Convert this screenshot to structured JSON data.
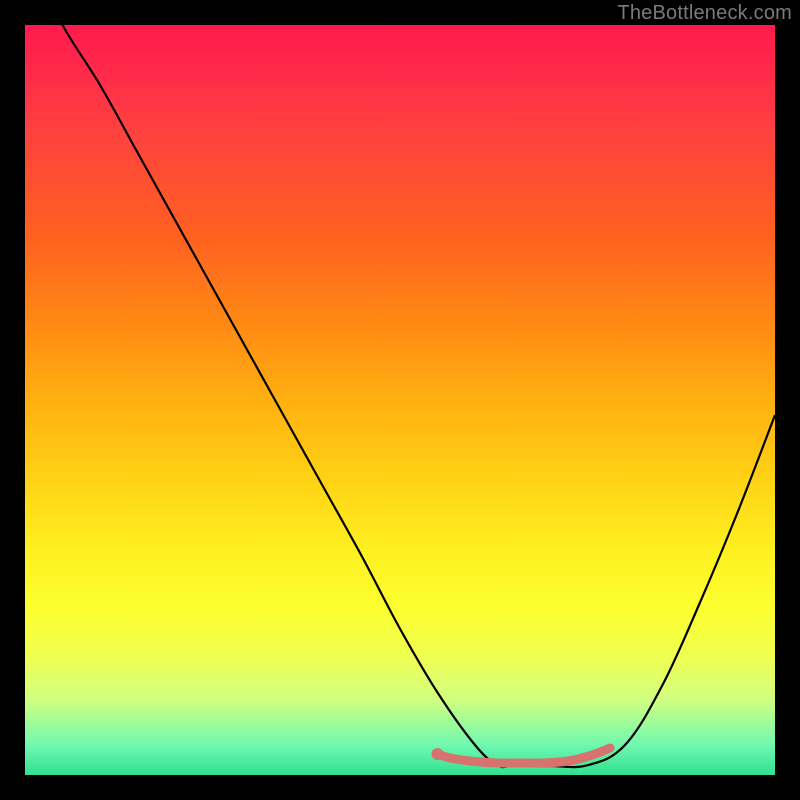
{
  "watermark": "TheBottleneck.com",
  "chart_data": {
    "type": "line",
    "title": "",
    "xlabel": "",
    "ylabel": "",
    "xlim": [
      0,
      100
    ],
    "ylim": [
      0,
      100
    ],
    "series": [
      {
        "name": "bottleneck-curve",
        "x": [
          0,
          5,
          10,
          15,
          20,
          25,
          30,
          35,
          40,
          45,
          50,
          55,
          60,
          63,
          65,
          70,
          75,
          80,
          85,
          90,
          95,
          100
        ],
        "values": [
          110,
          100,
          92,
          83,
          74,
          65,
          56,
          47,
          38,
          29,
          19.5,
          11,
          4,
          1.3,
          1.2,
          1.2,
          1.3,
          4,
          12,
          23,
          35,
          48
        ]
      },
      {
        "name": "optimal-range-marker",
        "x": [
          55,
          57,
          60,
          63,
          66,
          69,
          72,
          74,
          76,
          78
        ],
        "values": [
          2.8,
          2.2,
          1.8,
          1.6,
          1.6,
          1.6,
          1.8,
          2.2,
          2.8,
          3.6
        ]
      }
    ],
    "marker": {
      "name": "optimal-point",
      "x": 55,
      "y": 2.8
    },
    "colors": {
      "curve": "#000000",
      "marker_stroke": "#d8726e",
      "marker_fill": "#d8726e"
    }
  }
}
